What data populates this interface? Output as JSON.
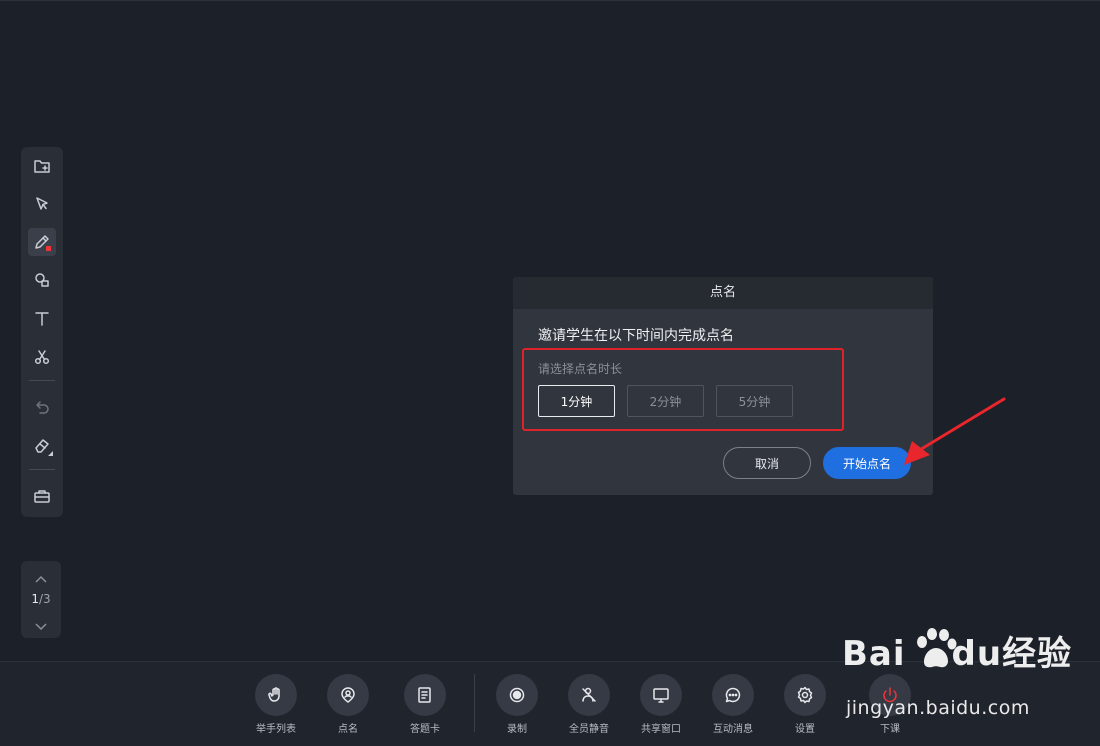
{
  "dialog": {
    "title": "点名",
    "message": "邀请学生在以下时间内完成点名",
    "subtitle": "请选择点名时长",
    "options": [
      {
        "label": "1分钟",
        "selected": true
      },
      {
        "label": "2分钟",
        "selected": false
      },
      {
        "label": "5分钟",
        "selected": false
      }
    ],
    "cancel_label": "取消",
    "start_label": "开始点名"
  },
  "pager": {
    "current": "1",
    "total": "/3"
  },
  "toolbar": {
    "tools": [
      "folder-add-icon",
      "pointer-icon",
      "pen-icon",
      "shapes-icon",
      "text-icon",
      "scissors-icon",
      "undo-icon",
      "eraser-icon",
      "toolbox-icon"
    ]
  },
  "bottom": {
    "items": [
      {
        "label": "举手列表",
        "icon": "raise-hand-icon"
      },
      {
        "label": "点名",
        "icon": "roll-call-icon"
      },
      {
        "label": "答题卡",
        "icon": "answer-card-icon"
      },
      {
        "label": "录制",
        "icon": "record-icon"
      },
      {
        "label": "全员静音",
        "icon": "mute-all-icon"
      },
      {
        "label": "共享窗口",
        "icon": "share-window-icon"
      },
      {
        "label": "互动消息",
        "icon": "message-icon"
      },
      {
        "label": "设置",
        "icon": "gear-icon"
      },
      {
        "label": "下课",
        "icon": "power-icon"
      }
    ]
  },
  "watermark": {
    "brand_a": "Bai",
    "brand_b": "du",
    "brand_c": "经验",
    "url": "jingyan.baidu.com"
  },
  "colors": {
    "accent": "#1f6fe0",
    "highlight": "#e0232a",
    "background": "#1c2029",
    "pen_dot": "#f0343a"
  }
}
